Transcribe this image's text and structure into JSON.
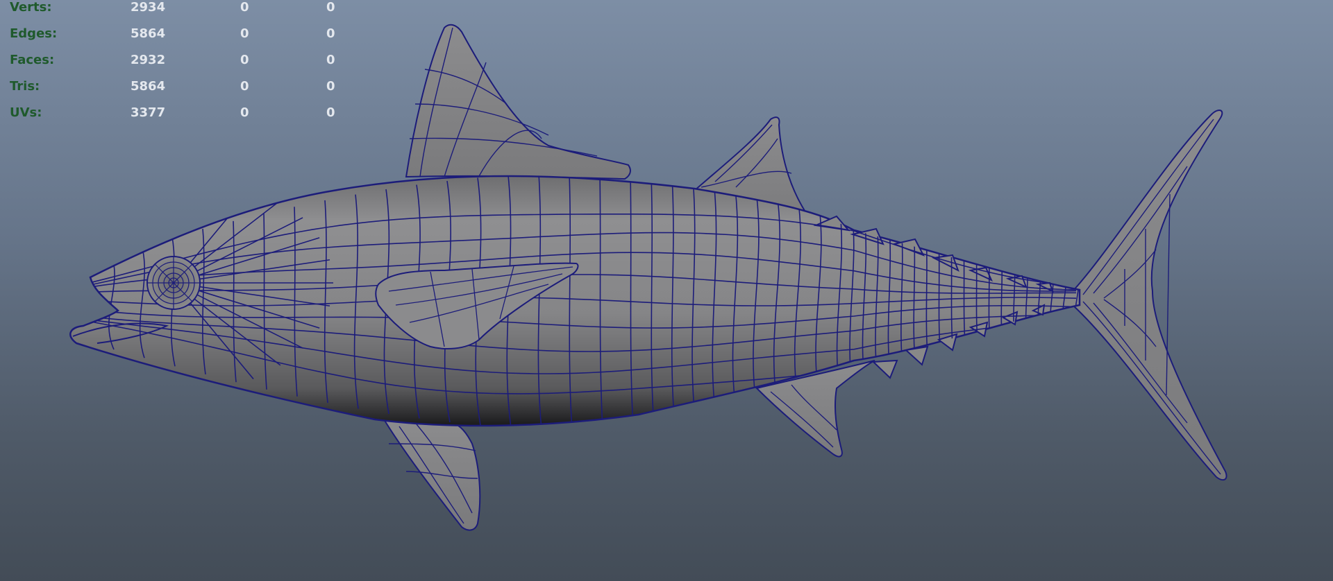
{
  "heads_up_display": {
    "rows": [
      {
        "label": "Verts:",
        "values": [
          "2934",
          "0",
          "0"
        ]
      },
      {
        "label": "Edges:",
        "values": [
          "5864",
          "0",
          "0"
        ]
      },
      {
        "label": "Faces:",
        "values": [
          "2932",
          "0",
          "0"
        ]
      },
      {
        "label": "Tris:",
        "values": [
          "5864",
          "0",
          "0"
        ]
      },
      {
        "label": "UVs:",
        "values": [
          "3377",
          "0",
          "0"
        ]
      }
    ]
  },
  "colors": {
    "background_top": "#7d8ea5",
    "background_bottom": "#434c57",
    "mesh_fill": "#8a8a8c",
    "wireframe": "#1c1c7a",
    "hud_label": "#1f5a2c",
    "hud_value": "#e4e8ee"
  },
  "viewport": {
    "object": "tuna-mesh",
    "display_mode": "wireframe-on-shaded"
  }
}
